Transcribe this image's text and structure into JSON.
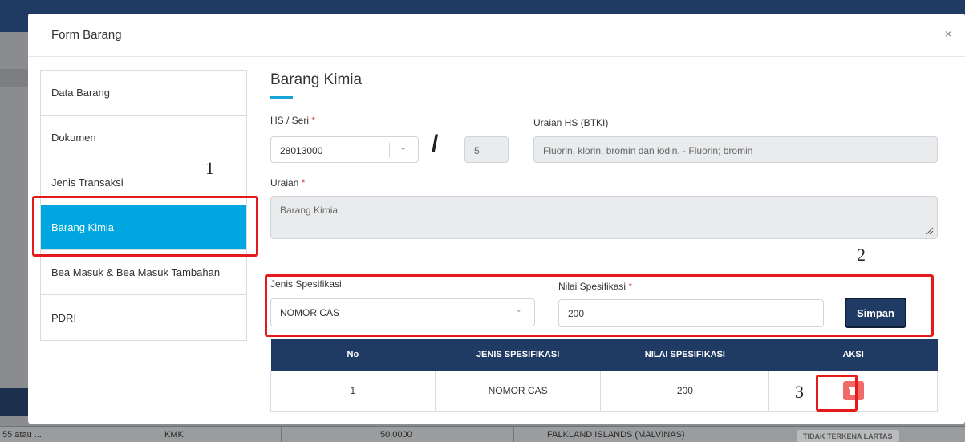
{
  "background": {
    "row": {
      "cells": [
        "55 atau ...",
        "KMK",
        "50.0000",
        "FALKLAND ISLANDS (MALVINAS)"
      ],
      "badge": "TIDAK TERKENA LARTAS"
    }
  },
  "modal": {
    "title": "Form Barang",
    "close": "×"
  },
  "sidebar": {
    "items": [
      {
        "label": "Data Barang"
      },
      {
        "label": "Dokumen"
      },
      {
        "label": "Jenis Transaksi"
      },
      {
        "label": "Barang Kimia"
      },
      {
        "label": "Bea Masuk & Bea Masuk Tambahan"
      },
      {
        "label": "PDRI"
      }
    ],
    "active": "Barang Kimia"
  },
  "form": {
    "section_title": "Barang Kimia",
    "hs_label": "HS / Seri",
    "hs_value": "28013000",
    "slash": "/",
    "seri_value": "5",
    "uraian_hs_label": "Uraian HS (BTKI)",
    "uraian_hs_value": "Fluorin, klorin, bromin dan iodin. - Fluorin; bromin",
    "uraian_label": "Uraian",
    "uraian_value": "Barang Kimia",
    "required_mark": "*",
    "jenis_spesifikasi_label": "Jenis Spesifikasi",
    "jenis_spesifikasi_value": "NOMOR CAS",
    "nilai_spesifikasi_label": "Nilai Spesifikasi",
    "nilai_spesifikasi_value": "200",
    "simpan_label": "Simpan"
  },
  "table": {
    "headers": [
      "No",
      "JENIS SPESIFIKASI",
      "NILAI SPESIFIKASI",
      "AKSI"
    ],
    "rows": [
      {
        "no": "1",
        "jenis": "NOMOR CAS",
        "nilai": "200"
      }
    ]
  },
  "annotations": {
    "one": "1",
    "two": "2",
    "three": "3"
  },
  "colors": {
    "primary": "#1f3b63",
    "active": "#00a6e0",
    "highlight": "#e51b1b",
    "danger": "#f06a6a"
  }
}
